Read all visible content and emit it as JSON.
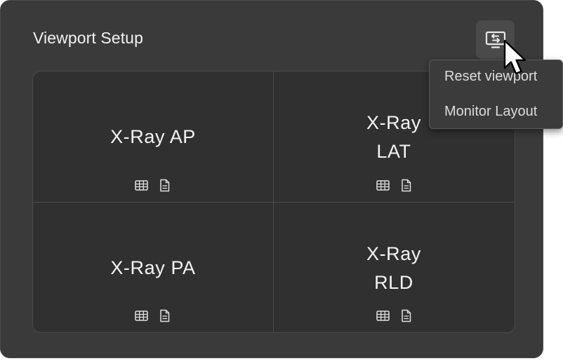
{
  "panel": {
    "title": "Viewport Setup",
    "header_button_icon": "monitor-swap-icon"
  },
  "viewports": [
    {
      "label": "X-Ray AP",
      "icons": [
        "grid-icon",
        "document-icon"
      ]
    },
    {
      "label": "X-Ray LAT",
      "icons": [
        "grid-icon",
        "document-icon"
      ]
    },
    {
      "label": "X-Ray PA",
      "icons": [
        "grid-icon",
        "document-icon"
      ]
    },
    {
      "label": "X-Ray RLD",
      "icons": [
        "grid-icon",
        "document-icon"
      ]
    }
  ],
  "menu": {
    "items": [
      {
        "label": "Reset viewport"
      },
      {
        "label": "Monitor Layout"
      }
    ]
  },
  "colors": {
    "panel_bg": "#3a3a3a",
    "grid_bg": "#303030",
    "text": "#f2f2f2",
    "menu_text": "#dcdcdc",
    "border": "#4a4a4a"
  }
}
